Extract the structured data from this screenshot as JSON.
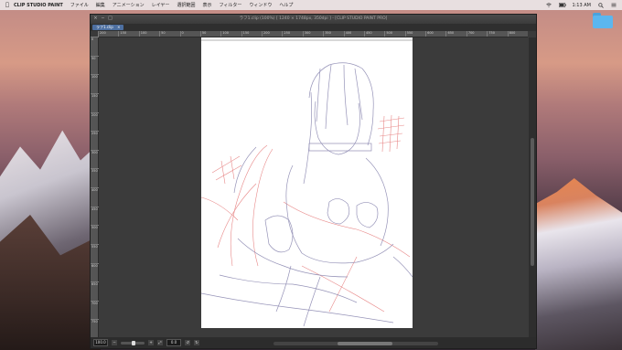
{
  "menubar": {
    "apple": "",
    "app_name": "CLIP STUDIO PAINT",
    "items": [
      "ファイル",
      "編集",
      "アニメーション",
      "レイヤー",
      "選択範囲",
      "表示",
      "フィルター",
      "ウィンドウ",
      "ヘルプ"
    ],
    "clock": "1:13 AM"
  },
  "desktop": {
    "folder_label": ""
  },
  "window": {
    "title": "ラフ1.clip (100%) [ 1240 × 1748px, 350dpi ] - [CLIP STUDIO PAINT PRO]",
    "tab_label": "ラフ1.clip",
    "tab_close": "×",
    "ruler_h": [
      "200",
      "150",
      "100",
      "50",
      "0",
      "50",
      "100",
      "150",
      "200",
      "250",
      "300",
      "350",
      "400",
      "450",
      "500",
      "550",
      "600",
      "650",
      "700",
      "750",
      "800"
    ],
    "ruler_v": [
      "0",
      "50",
      "100",
      "150",
      "200",
      "250",
      "300",
      "350",
      "400",
      "450",
      "500",
      "550",
      "600",
      "650",
      "700",
      "750"
    ],
    "status": {
      "zoom": "100.0",
      "angle": "0.0"
    }
  },
  "colors": {
    "sketch_blue": "#8a87b0",
    "sketch_red": "#e26a6a",
    "tab_blue": "#4d6fa0"
  }
}
